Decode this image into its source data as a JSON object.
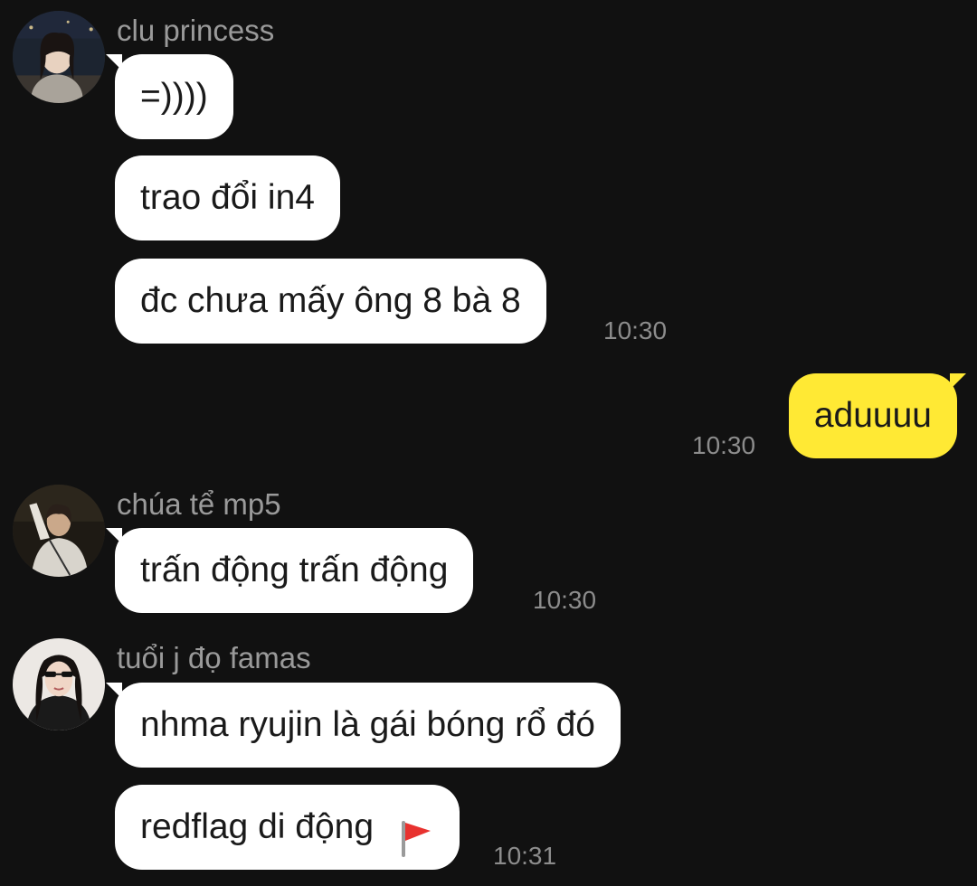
{
  "messages": {
    "group1": {
      "sender": "clu princess",
      "avatar_icon": "user-avatar-girl-night",
      "bubbles": [
        "=))))",
        "trao đổi in4",
        "đc chưa mấy ông 8 bà 8"
      ],
      "time": "10:30"
    },
    "own1": {
      "text": "aduuuu",
      "time": "10:30"
    },
    "group2": {
      "sender": "chúa tể mp5",
      "avatar_icon": "user-avatar-boy",
      "bubbles": [
        "trấn động trấn động"
      ],
      "time": "10:30"
    },
    "group3": {
      "sender": "tuổi j đọ famas",
      "avatar_icon": "user-avatar-girl-sunglasses",
      "bubbles": [
        "nhma ryujin là gái bóng rổ đó",
        "redflag di động"
      ],
      "trailing_icon": "red-flag-icon",
      "time": "10:31"
    }
  },
  "colors": {
    "background": "#111111",
    "incoming_bubble": "#ffffff",
    "outgoing_bubble": "#ffe934",
    "sender_text": "#9a9a9a",
    "time_text": "#8c8c8c"
  }
}
